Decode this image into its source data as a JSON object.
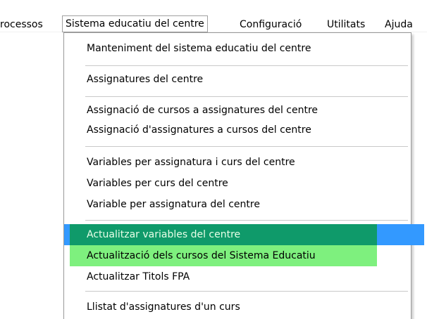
{
  "menubar": {
    "items": [
      {
        "label": "rocessos"
      },
      {
        "label": "Sistema educatiu del centre"
      },
      {
        "label": "Configuració"
      },
      {
        "label": "Utilitats"
      },
      {
        "label": "Ajuda"
      }
    ]
  },
  "dropdown": {
    "items": [
      {
        "label": "Manteniment del sistema educatiu del centre"
      },
      {
        "label": "Assignatures del centre"
      },
      {
        "label": "Assignació de cursos a assignatures del centre"
      },
      {
        "label": "Assignació d'assignatures a cursos del centre"
      },
      {
        "label": "Variables per assignatura i curs del centre"
      },
      {
        "label": "Variables per curs del centre"
      },
      {
        "label": "Variable per assignatura del centre"
      },
      {
        "label": "Actualitzar variables del centre"
      },
      {
        "label": "Actualització dels cursos del Sistema Educatiu"
      },
      {
        "label": "Actualitzar Titols FPA"
      },
      {
        "label": "Llistat d'assignatures d'un curs"
      }
    ]
  },
  "colors": {
    "selection": "#3399ff",
    "highlight_dark_green": "#0f9a6a",
    "highlight_light_green": "#7ef07e"
  }
}
